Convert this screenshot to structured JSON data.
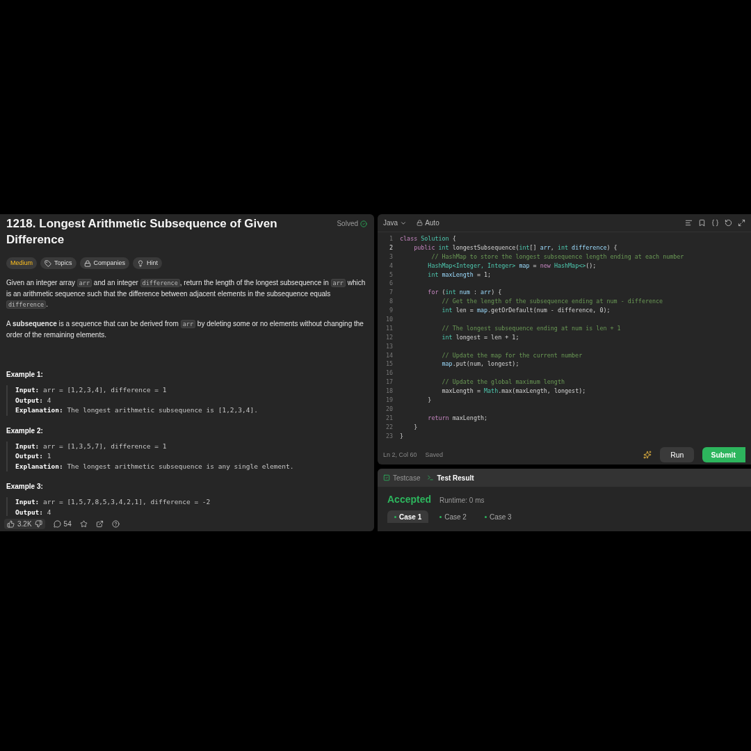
{
  "problem": {
    "title": "1218. Longest Arithmetic Subsequence of Given Difference",
    "status": "Solved",
    "difficulty": "Medium",
    "tags": [
      {
        "kind": "topics",
        "label": "Topics"
      },
      {
        "kind": "companies",
        "label": "Companies"
      },
      {
        "kind": "hint",
        "label": "Hint"
      }
    ],
    "paragraphs": [
      [
        {
          "kind": "text",
          "text": "Given an integer array "
        },
        {
          "kind": "code",
          "text": "arr"
        },
        {
          "kind": "text",
          "text": " and an integer "
        },
        {
          "kind": "code",
          "text": "difference"
        },
        {
          "kind": "text",
          "text": ", return the length of the longest subsequence in "
        },
        {
          "kind": "code",
          "text": "arr"
        },
        {
          "kind": "text",
          "text": " which is an arithmetic sequence such that the difference between adjacent elements in the subsequence equals "
        },
        {
          "kind": "code",
          "text": "difference"
        },
        {
          "kind": "text",
          "text": "."
        }
      ],
      [
        {
          "kind": "text",
          "text": "A **subsequence** is a sequence that can be derived from "
        },
        {
          "kind": "code",
          "text": "arr"
        },
        {
          "kind": "text",
          "text": " by deleting some or no elements without changing the order of the remaining elements."
        }
      ]
    ],
    "examples": [
      {
        "title": "Example 1:",
        "lines": [
          {
            "label": "Input:",
            "value": "arr = [1,2,3,4], difference = 1"
          },
          {
            "label": "Output:",
            "value": "4"
          },
          {
            "label": "Explanation:",
            "value": "The longest arithmetic subsequence is [1,2,3,4]."
          }
        ]
      },
      {
        "title": "Example 2:",
        "lines": [
          {
            "label": "Input:",
            "value": "arr = [1,3,5,7], difference = 1"
          },
          {
            "label": "Output:",
            "value": "1"
          },
          {
            "label": "Explanation:",
            "value": "The longest arithmetic subsequence is any single element."
          }
        ]
      },
      {
        "title": "Example 3:",
        "lines": [
          {
            "label": "Input:",
            "value": "arr = [1,5,7,8,5,3,4,2,1], difference = -2"
          },
          {
            "label": "Output:",
            "value": "4"
          }
        ]
      }
    ],
    "footer": {
      "likes": "3.2K",
      "comments": "54"
    }
  },
  "editor": {
    "language": "Java",
    "mode": "Auto",
    "position": "Ln 2, Col 60",
    "save_state": "Saved",
    "run": "Run",
    "submit": "Submit",
    "lines": [
      {
        "number": "1",
        "active": false,
        "tokens": [
          {
            "kind": "keyword",
            "text": "class"
          },
          {
            "kind": "type",
            "text": " Solution"
          },
          {
            "kind": "plain",
            "text": " {"
          }
        ]
      },
      {
        "number": "2",
        "active": true,
        "tokens": [
          {
            "kind": "keyword",
            "text": "    public"
          },
          {
            "kind": "type",
            "text": " int"
          },
          {
            "kind": "plain",
            "text": " longestSubsequence("
          },
          {
            "kind": "type",
            "text": "int"
          },
          {
            "kind": "plain",
            "text": "[]"
          },
          {
            "kind": "variable",
            "text": " arr"
          },
          {
            "kind": "plain",
            "text": ","
          },
          {
            "kind": "type",
            "text": " int"
          },
          {
            "kind": "variable",
            "text": " difference"
          },
          {
            "kind": "plain",
            "text": ") {"
          }
        ]
      },
      {
        "number": "3",
        "active": false,
        "tokens": [
          {
            "kind": "comment",
            "text": "         // HashMap to store the longest subsequence length ending at each number"
          }
        ]
      },
      {
        "number": "4",
        "active": false,
        "tokens": [
          {
            "kind": "type",
            "text": "        HashMap<Integer, Integer>"
          },
          {
            "kind": "variable",
            "text": " map"
          },
          {
            "kind": "plain",
            "text": " ="
          },
          {
            "kind": "keyword",
            "text": " new"
          },
          {
            "kind": "type",
            "text": " HashMap<>"
          },
          {
            "kind": "plain",
            "text": "();"
          }
        ]
      },
      {
        "number": "5",
        "active": false,
        "tokens": [
          {
            "kind": "type",
            "text": "        int"
          },
          {
            "kind": "variable",
            "text": " maxLength"
          },
          {
            "kind": "plain",
            "text": " = 1;"
          }
        ]
      },
      {
        "number": "6",
        "active": false
      },
      {
        "number": "7",
        "active": false,
        "tokens": [
          {
            "kind": "keyword",
            "text": "        for"
          },
          {
            "kind": "plain",
            "text": " ("
          },
          {
            "kind": "type",
            "text": "int"
          },
          {
            "kind": "variable",
            "text": " num"
          },
          {
            "kind": "plain",
            "text": " :"
          },
          {
            "kind": "variable",
            "text": " arr"
          },
          {
            "kind": "plain",
            "text": ") {"
          }
        ]
      },
      {
        "number": "8",
        "active": false,
        "tokens": [
          {
            "kind": "comment",
            "text": "            // Get the length of the subsequence ending at num - difference"
          }
        ]
      },
      {
        "number": "9",
        "active": false,
        "tokens": [
          {
            "kind": "type",
            "text": "            int"
          },
          {
            "kind": "plain",
            "text": " len ="
          },
          {
            "kind": "variable",
            "text": " map"
          },
          {
            "kind": "plain",
            "text": ".getOrDefault(num - difference, 0);"
          }
        ]
      },
      {
        "number": "10",
        "active": false
      },
      {
        "number": "11",
        "active": false,
        "tokens": [
          {
            "kind": "comment",
            "text": "            // The longest subsequence ending at num is len + 1"
          }
        ]
      },
      {
        "number": "12",
        "active": false,
        "tokens": [
          {
            "kind": "type",
            "text": "            int"
          },
          {
            "kind": "plain",
            "text": " longest = len + 1;"
          }
        ]
      },
      {
        "number": "13",
        "active": false
      },
      {
        "number": "14",
        "active": false,
        "tokens": [
          {
            "kind": "comment",
            "text": "            // Update the map for the current number"
          }
        ]
      },
      {
        "number": "15",
        "active": false,
        "tokens": [
          {
            "kind": "variable",
            "text": "            map"
          },
          {
            "kind": "plain",
            "text": ".put(num, longest);"
          }
        ]
      },
      {
        "number": "16",
        "active": false
      },
      {
        "number": "17",
        "active": false,
        "tokens": [
          {
            "kind": "comment",
            "text": "            // Update the global maximum length"
          }
        ]
      },
      {
        "number": "18",
        "active": false,
        "tokens": [
          {
            "kind": "plain",
            "text": "            maxLength ="
          },
          {
            "kind": "type",
            "text": " Math"
          },
          {
            "kind": "plain",
            "text": ".max(maxLength, longest);"
          }
        ]
      },
      {
        "number": "19",
        "active": false,
        "tokens": [
          {
            "kind": "plain",
            "text": "        }"
          }
        ]
      },
      {
        "number": "20",
        "active": false
      },
      {
        "number": "21",
        "active": false,
        "tokens": [
          {
            "kind": "keyword",
            "text": "        return"
          },
          {
            "kind": "plain",
            "text": " maxLength;"
          }
        ]
      },
      {
        "number": "22",
        "active": false,
        "tokens": [
          {
            "kind": "plain",
            "text": "    }"
          }
        ]
      },
      {
        "number": "23",
        "active": false,
        "tokens": [
          {
            "kind": "plain",
            "text": "}"
          }
        ]
      }
    ]
  },
  "results": {
    "tabs": [
      {
        "kind": "testcase",
        "label": "Testcase",
        "selected": false
      },
      {
        "kind": "result",
        "label": "Test Result",
        "selected": true
      }
    ],
    "verdict": "Accepted",
    "runtime": "Runtime: 0 ms",
    "cases": [
      {
        "label": "Case 1",
        "selected": true
      },
      {
        "label": "Case 2",
        "selected": false
      },
      {
        "label": "Case 3",
        "selected": false
      }
    ]
  }
}
